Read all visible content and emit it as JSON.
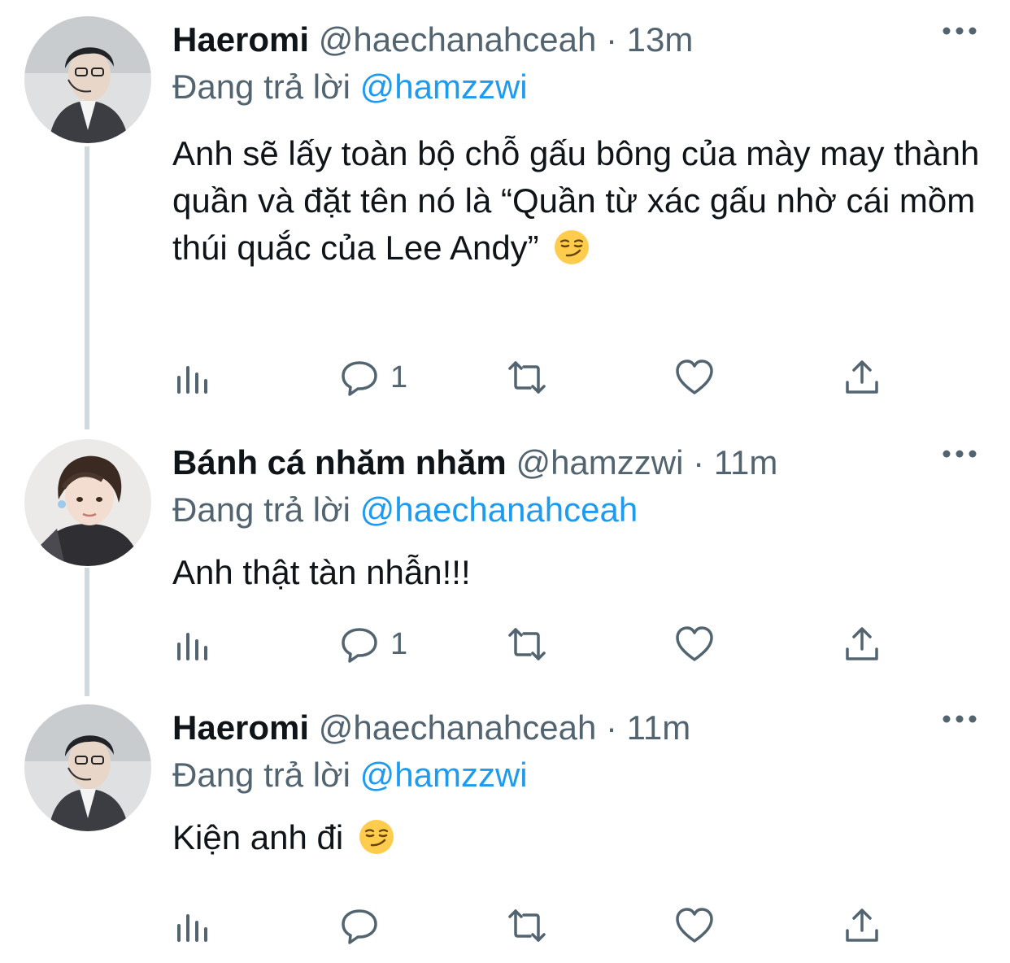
{
  "tweets": [
    {
      "display_name": "Haeromi",
      "handle": "@haechanahceah",
      "separator": "·",
      "time": "13m",
      "replying_prefix": "Đang trả lời",
      "replying_to": "@hamzzwi",
      "text": "Anh sẽ lấy toàn bộ chỗ gấu bông của mày may thành quần và đặt tên nó là “Quần từ xác gấu nhờ cái mồm thúi quắc của Lee Andy”",
      "emoji": "smirking-face",
      "reply_count": "1"
    },
    {
      "display_name": "Bánh cá nhăm nhăm",
      "handle": "@hamzzwi",
      "separator": "·",
      "time": "11m",
      "replying_prefix": "Đang trả lời",
      "replying_to": "@haechanahceah",
      "text": "Anh thật tàn nhẫn!!!",
      "reply_count": "1"
    },
    {
      "display_name": "Haeromi",
      "handle": "@haechanahceah",
      "separator": "·",
      "time": "11m",
      "replying_prefix": "Đang trả lời",
      "replying_to": "@hamzzwi",
      "text": "Kiện anh đi",
      "emoji": "smirking-face",
      "reply_count": ""
    }
  ],
  "icons": {
    "views": "bar-chart-icon",
    "reply": "speech-bubble-icon",
    "retweet": "retweet-arrows-icon",
    "like": "heart-icon",
    "share": "share-upload-icon",
    "more": "three-dots-icon"
  },
  "colors": {
    "text": "#0f1419",
    "secondary": "#536471",
    "link": "#1d9bf0",
    "thread_line": "#cfd9de"
  }
}
